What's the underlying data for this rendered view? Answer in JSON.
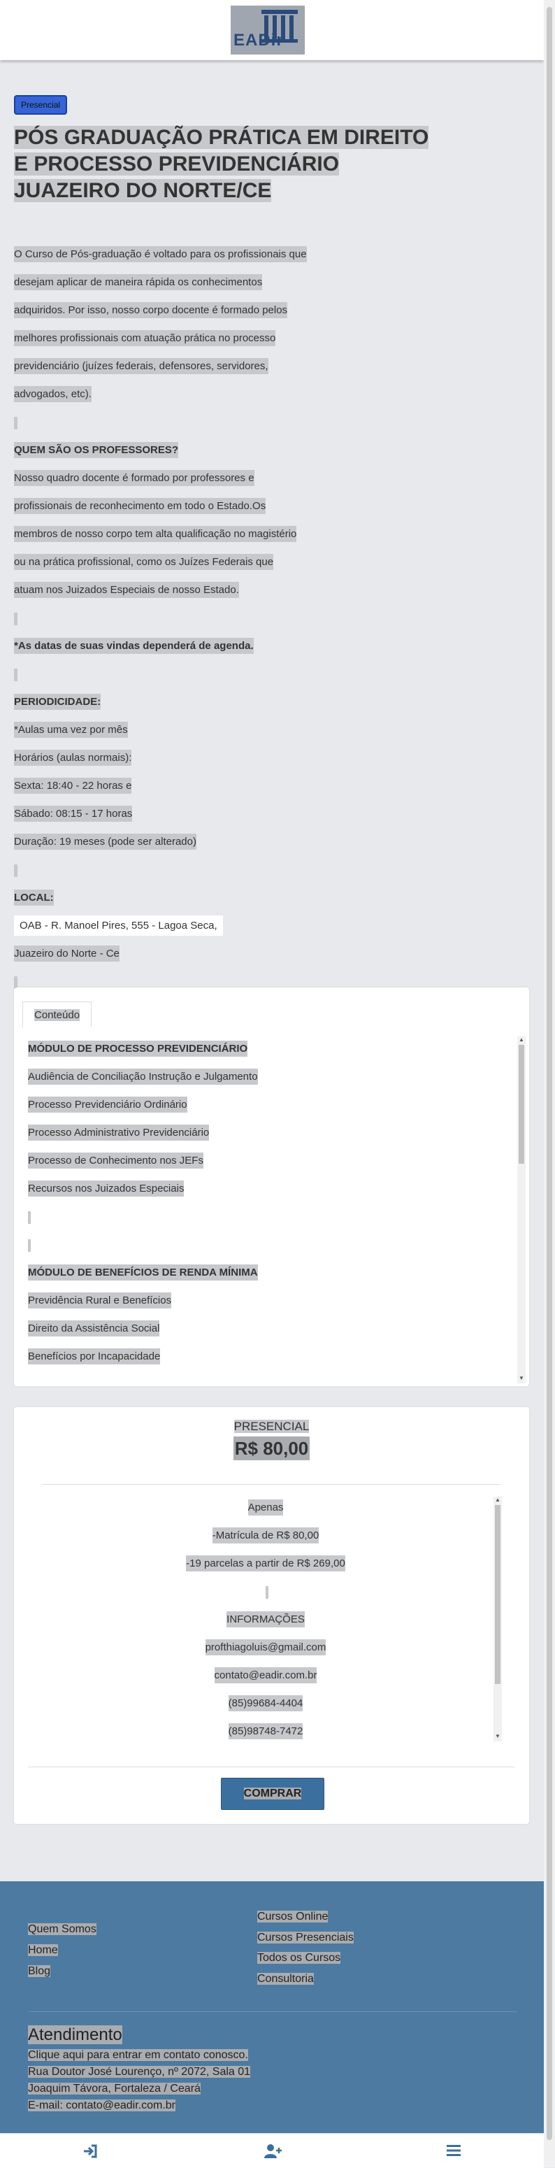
{
  "header": {
    "logo_text": "EADir"
  },
  "course": {
    "badge": "Presencial",
    "title": "PÓS GRADUAÇÃO PRÁTICA EM DIREITO E PROCESSO PREVIDENCIÁRIO JUAZEIRO DO NORTE/CE",
    "intro": [
      "O Curso de Pós-graduação é voltado para os profissionais que",
      "desejam aplicar de maneira rápida os conhecimentos",
      "adquiridos. Por isso, nosso corpo docente é formado pelos",
      "melhores profissionais com atuação prática no processo",
      "previdenciário (juízes federais, defensores, servidores,",
      "advogados, etc)."
    ],
    "professors_heading": "QUEM SÃO OS PROFESSORES?",
    "professors_text": [
      "Nosso quadro docente é formado por professores e",
      "profissionais de reconhecimento em todo o Estado.Os",
      "membros de nosso corpo tem alta qualificação no magistério",
      "ou na prática profissional, como os Juízes Federais que",
      "atuam nos Juizados Especiais de nosso Estado."
    ],
    "agenda_note": "*As datas de suas vindas dependerá de agenda.",
    "periodicity_heading": "PERIODICIDADE:",
    "periodicity_lines": [
      "*Aulas uma vez por mês",
      "Horários (aulas normais):",
      "Sexta: 18:40 - 22 horas e",
      "Sábado: 08:15 - 17 horas",
      "Duração: 19 meses (pode ser alterado)"
    ],
    "location_heading": "LOCAL:",
    "location_address": "OAB - R. Manoel Pires, 555 - Lagoa Seca,",
    "location_city": "Juazeiro do Norte - Ce"
  },
  "content_card": {
    "tab_label": "Conteúdo",
    "module1_title": "MÓDULO DE PROCESSO PREVIDENCIÁRIO",
    "module1_items": [
      "Audiência de Conciliação Instrução e Julgamento",
      "Processo Previdenciário Ordinário",
      "Processo Administrativo Previdenciário",
      "Processo de Conhecimento nos JEFs",
      "Recursos nos Juizados Especiais"
    ],
    "module2_title": "MÓDULO DE BENEFÍCIOS DE RENDA MÍNIMA",
    "module2_items": [
      "Previdência Rural e Benefícios",
      "Direito da Assistência Social",
      "Benefícios por Incapacidade"
    ]
  },
  "price_card": {
    "type": "PRESENCIAL",
    "price": "R$ 80,00",
    "details": [
      "Apenas",
      "-Matrícula de R$ 80,00",
      "-19 parcelas a partir de R$ 269,00"
    ],
    "info_heading": "INFORMAÇÕES",
    "contacts": [
      "profthiagoluis@gmail.com",
      "contato@eadir.com.br",
      "(85)99684-4404",
      "(85)98748-7472"
    ],
    "buy_label": "COMPRAR"
  },
  "footer": {
    "left_links": [
      "Quem Somos",
      "Home",
      "Blog"
    ],
    "right_links": [
      "Cursos Online",
      "Cursos Presenciais",
      "Todos os Cursos",
      "Consultoria"
    ],
    "support_title": "Atendimento",
    "support_lines": [
      "Clique aqui para entrar em contato conosco.",
      "Rua Doutor José Lourenço, nº 2072, Sala 01",
      "Joaquim Távora, Fortaleza / Ceará",
      "E-mail: contato@eadir.com.br"
    ]
  },
  "bottom_nav": {
    "icons": [
      "login-icon",
      "add-user-icon",
      "menu-icon"
    ]
  },
  "colors": {
    "badge": "#3564d4",
    "footer_bg": "#4c7aa1",
    "buy_button": "#3b6f9e",
    "nav_icon": "#3b6f9e"
  }
}
